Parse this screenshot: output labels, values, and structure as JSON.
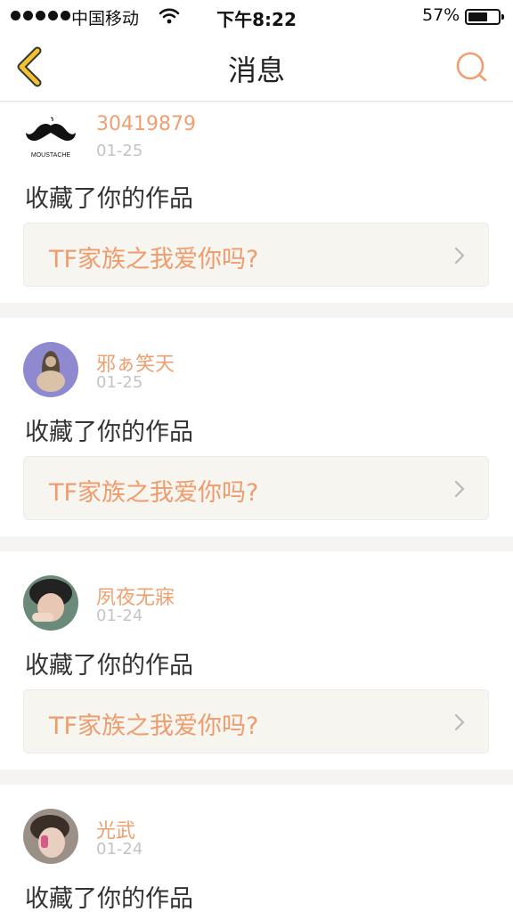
{
  "status_bar": {
    "carrier": "中国移动",
    "time": "下午8:22",
    "battery_percent": "57%",
    "battery_level": 0.57
  },
  "nav": {
    "title": "消息",
    "back_icon": "chevron-left-icon",
    "search_icon": "search-icon"
  },
  "colors": {
    "accent": "#f0a070",
    "back_arrow": "#f2c230",
    "link_background": "#f6f5ef"
  },
  "messages": [
    {
      "user": "30419879",
      "date": "01-25",
      "action": "收藏了你的作品",
      "work_title": "TF家族之我爱你吗?",
      "avatar_text": "MOUSTACHE"
    },
    {
      "user": "邪ぁ笑天",
      "date": "01-25",
      "action": "收藏了你的作品",
      "work_title": "TF家族之我爱你吗?"
    },
    {
      "user": "夙夜无寐",
      "date": "01-24",
      "action": "收藏了你的作品",
      "work_title": "TF家族之我爱你吗?"
    },
    {
      "user": "光武",
      "date": "01-24",
      "action": "收藏了你的作品"
    }
  ]
}
